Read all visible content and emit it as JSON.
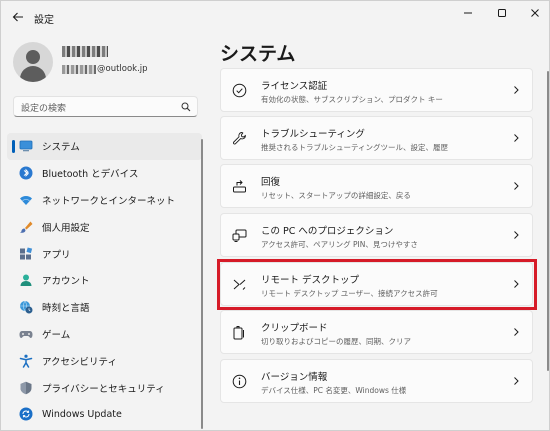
{
  "window": {
    "app_title": "設定",
    "controls": {
      "minimize_icon": "minimize-icon",
      "maximize_icon": "maximize-icon",
      "close_icon": "close-icon"
    }
  },
  "profile": {
    "email_domain": "@outlook.jp"
  },
  "search": {
    "placeholder": "設定の検索"
  },
  "sidebar": {
    "items": [
      {
        "label": "システム",
        "icon": "monitor-icon",
        "selected": true
      },
      {
        "label": "Bluetooth とデバイス",
        "icon": "bluetooth-icon"
      },
      {
        "label": "ネットワークとインターネット",
        "icon": "wifi-icon"
      },
      {
        "label": "個人用設定",
        "icon": "brush-icon"
      },
      {
        "label": "アプリ",
        "icon": "apps-icon"
      },
      {
        "label": "アカウント",
        "icon": "person-icon"
      },
      {
        "label": "時刻と言語",
        "icon": "globe-clock-icon"
      },
      {
        "label": "ゲーム",
        "icon": "gamepad-icon"
      },
      {
        "label": "アクセシビリティ",
        "icon": "accessibility-icon"
      },
      {
        "label": "プライバシーとセキュリティ",
        "icon": "shield-icon"
      },
      {
        "label": "Windows Update",
        "icon": "update-icon"
      }
    ]
  },
  "main": {
    "title": "システム",
    "cards": [
      {
        "title": "ライセンス認証",
        "subtitle": "有効化の状態、サブスクリプション、プロダクト キー",
        "icon": "check-circle-icon"
      },
      {
        "title": "トラブルシューティング",
        "subtitle": "推奨されるトラブルシューティングツール、設定、履歴",
        "icon": "wrench-icon"
      },
      {
        "title": "回復",
        "subtitle": "リセット、スタートアップの詳細設定、戻る",
        "icon": "recovery-icon"
      },
      {
        "title": "この PC へのプロジェクション",
        "subtitle": "アクセス許可、ペアリング PIN、見つけやすさ",
        "icon": "projection-icon"
      },
      {
        "title": "リモート デスクトップ",
        "subtitle": "リモート デスクトップ ユーザー、接続アクセス許可",
        "icon": "remote-desktop-icon",
        "highlighted": true
      },
      {
        "title": "クリップボード",
        "subtitle": "切り取りおよびコピーの履歴、同期、クリア",
        "icon": "clipboard-icon"
      },
      {
        "title": "バージョン情報",
        "subtitle": "デバイス仕様、PC 名変更、Windows 仕様",
        "icon": "info-icon"
      }
    ]
  },
  "colors": {
    "accent": "#005fb8",
    "highlight_border": "#d61b28",
    "background": "#f3f3f3",
    "card": "#fbfbfb"
  }
}
